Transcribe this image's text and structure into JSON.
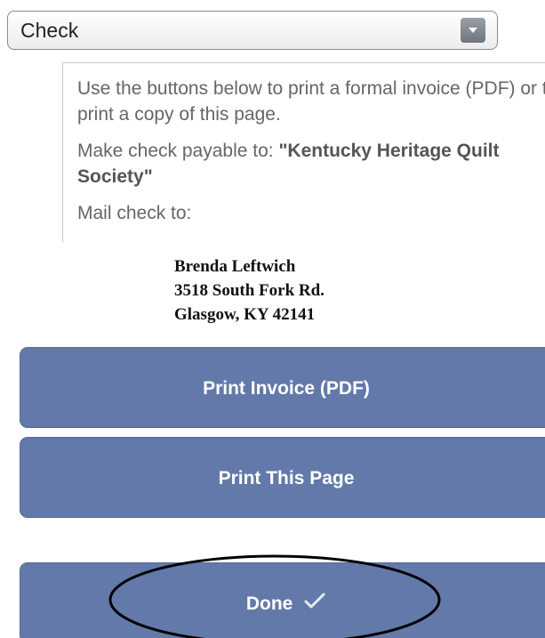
{
  "payment_method": {
    "selected": "Check"
  },
  "info": {
    "instructions": "Use the buttons below to print a formal invoice (PDF) or to print a copy of this page.",
    "payable_prefix": "Make check payable to: ",
    "payee": "\"Kentucky Heritage Quilt Society\"",
    "mail_label": "Mail check to:"
  },
  "address": {
    "name": "Brenda Leftwich",
    "street": "3518 South Fork Rd.",
    "city_state_zip": "Glasgow, KY 42141"
  },
  "buttons": {
    "print_invoice": "Print Invoice (PDF)",
    "print_page": "Print This Page",
    "done": "Done"
  },
  "colors": {
    "button_bg": "#6379a9",
    "annotation_oval": "#000000"
  }
}
